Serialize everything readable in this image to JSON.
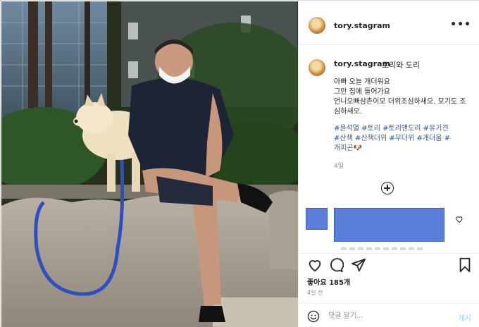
{
  "post": {
    "photo_icon": "photo-of-man-with-dog"
  },
  "header": {
    "username": "tory.stagram",
    "more_icon": "more-horizontal-icon",
    "more_label": "•••"
  },
  "caption": {
    "username": "tory.stagram",
    "name": "토리와 도리",
    "text": "아빠 오늘 개더워요\n그만 집에 들어가요\n언니오빠삼촌이모 더위조심하새오. 모기도 조심하새오.",
    "hashtags": "#윤석열 #토리 #토리앤도리 #유기견\n#산책 #산책더위 #무더위 #개더움 #\n개피곤🐶",
    "age": "4일"
  },
  "actions": {
    "likes": "좋아요 185개",
    "age": "4일 전"
  },
  "comment_box": {
    "placeholder": "댓글 달기...",
    "post_label": "게시"
  },
  "colors": {
    "redaction": "#5b7fd9",
    "hashtag": "#3b5998",
    "post_button": "#b2dffc"
  }
}
